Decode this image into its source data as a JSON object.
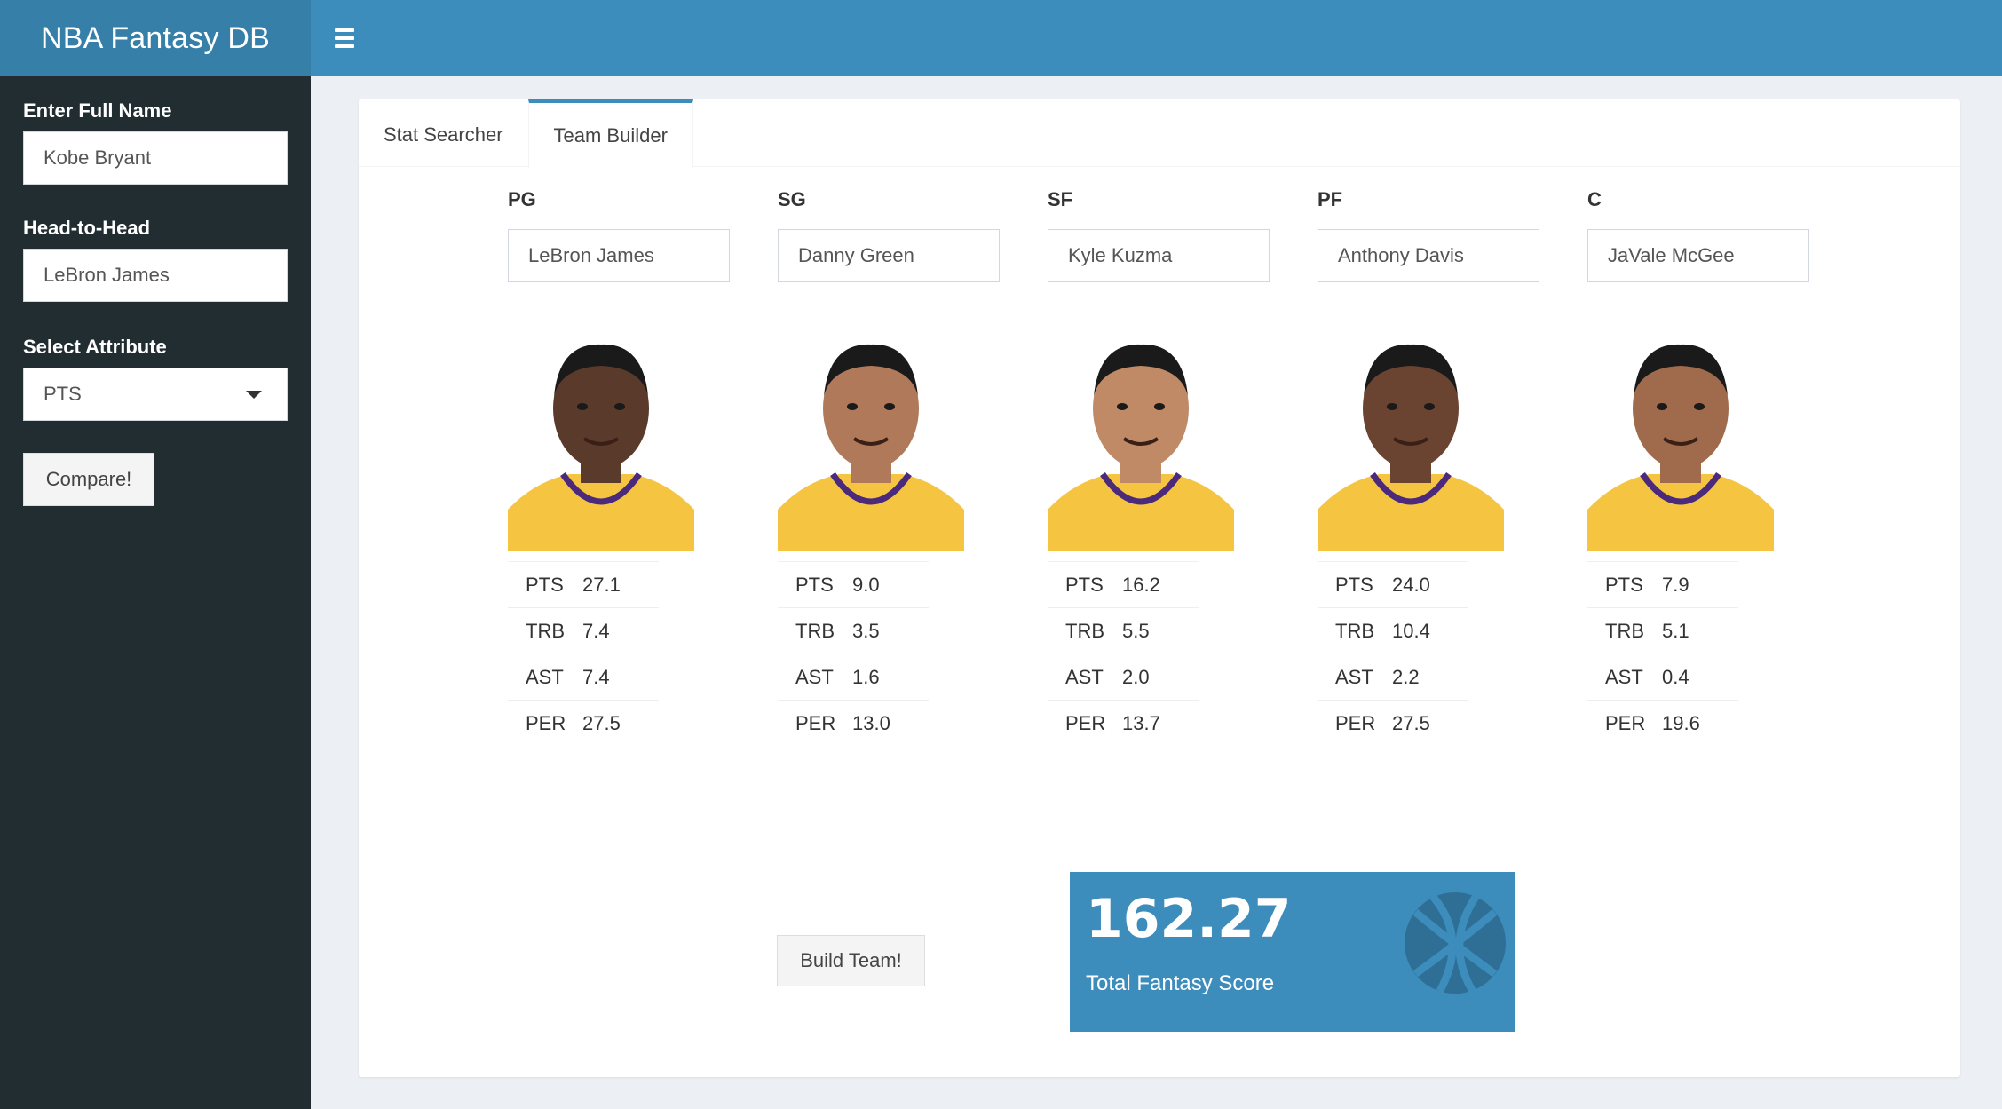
{
  "app": {
    "title": "NBA Fantasy DB"
  },
  "sidebar": {
    "full_name_label": "Enter Full Name",
    "full_name_value": "Kobe Bryant",
    "h2h_label": "Head-to-Head",
    "h2h_value": "LeBron James",
    "attribute_label": "Select Attribute",
    "attribute_value": "PTS",
    "compare_label": "Compare!"
  },
  "tabs": [
    {
      "label": "Stat Searcher",
      "active": false
    },
    {
      "label": "Team Builder",
      "active": true
    }
  ],
  "team": [
    {
      "position": "PG",
      "player": "LeBron James",
      "stats": [
        {
          "name": "PTS",
          "value": "27.1"
        },
        {
          "name": "TRB",
          "value": "7.4"
        },
        {
          "name": "AST",
          "value": "7.4"
        },
        {
          "name": "PER",
          "value": "27.5"
        }
      ]
    },
    {
      "position": "SG",
      "player": "Danny Green",
      "stats": [
        {
          "name": "PTS",
          "value": "9.0"
        },
        {
          "name": "TRB",
          "value": "3.5"
        },
        {
          "name": "AST",
          "value": "1.6"
        },
        {
          "name": "PER",
          "value": "13.0"
        }
      ]
    },
    {
      "position": "SF",
      "player": "Kyle Kuzma",
      "stats": [
        {
          "name": "PTS",
          "value": "16.2"
        },
        {
          "name": "TRB",
          "value": "5.5"
        },
        {
          "name": "AST",
          "value": "2.0"
        },
        {
          "name": "PER",
          "value": "13.7"
        }
      ]
    },
    {
      "position": "PF",
      "player": "Anthony Davis",
      "stats": [
        {
          "name": "PTS",
          "value": "24.0"
        },
        {
          "name": "TRB",
          "value": "10.4"
        },
        {
          "name": "AST",
          "value": "2.2"
        },
        {
          "name": "PER",
          "value": "27.5"
        }
      ]
    },
    {
      "position": "C",
      "player": "JaVale McGee",
      "stats": [
        {
          "name": "PTS",
          "value": "7.9"
        },
        {
          "name": "TRB",
          "value": "5.1"
        },
        {
          "name": "AST",
          "value": "0.4"
        },
        {
          "name": "PER",
          "value": "19.6"
        }
      ]
    }
  ],
  "build_label": "Build Team!",
  "score": {
    "value": "162.27",
    "label": "Total Fantasy Score"
  },
  "colors": {
    "header": "#3c8dbc",
    "brand": "#367fa9",
    "sidebar": "#222d32",
    "jersey": "#f5c542",
    "jersey_trim": "#4b2a7b"
  },
  "icons": {
    "menu": "hamburger-icon",
    "score": "basketball-icon",
    "dropdown": "caret-down-icon"
  }
}
